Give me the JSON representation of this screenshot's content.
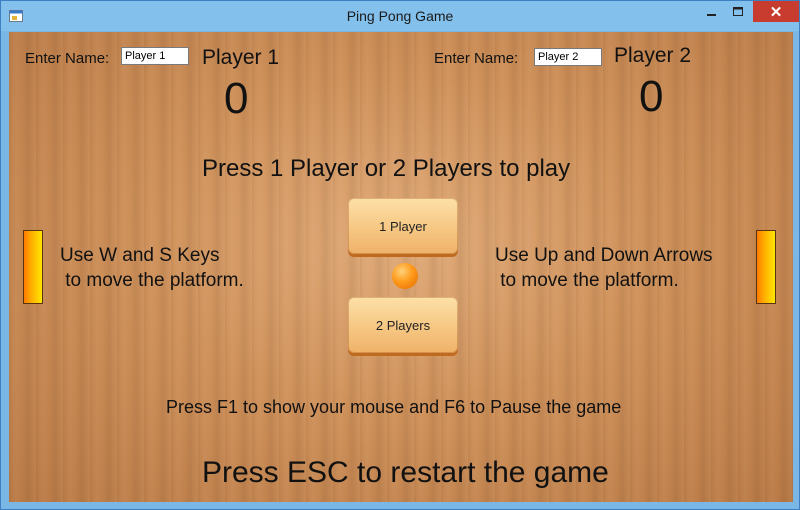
{
  "window": {
    "title": "Ping Pong Game"
  },
  "player1": {
    "name_label": "Enter Name:",
    "name_value": "Player 1",
    "title": "Player 1",
    "score": "0"
  },
  "player2": {
    "name_label": "Enter Name:",
    "name_value": "Player 2",
    "title": "Player 2",
    "score": "0"
  },
  "messages": {
    "start": "Press  1 Player or 2 Players to play",
    "left_controls": "Use W and S Keys\n to move the platform.",
    "right_controls": "Use Up and Down Arrows\n to move the platform.",
    "f1_f6": "Press F1 to show your mouse and F6 to Pause the game",
    "esc": "Press ESC to restart the game"
  },
  "buttons": {
    "one_player": "1 Player",
    "two_players": "2 Players"
  },
  "colors": {
    "paddle_start": "#ff7a00",
    "paddle_end": "#ffe600",
    "ball": "#ff9a1a",
    "close_button": "#c83c30"
  }
}
